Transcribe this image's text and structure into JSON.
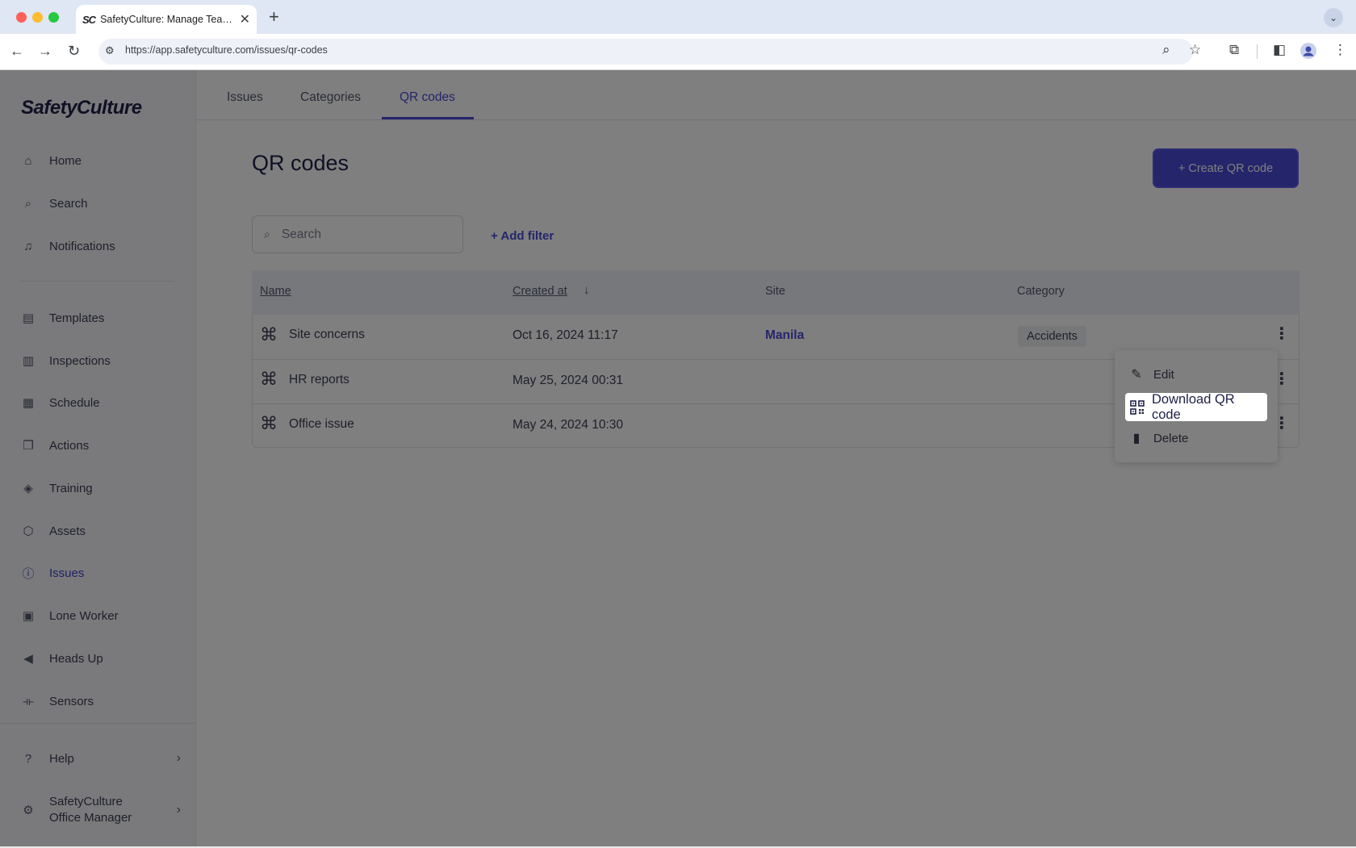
{
  "browser": {
    "tab_title": "SafetyCulture: Manage Teams and...",
    "tab_favicon": "SC",
    "url": "https://app.safetyculture.com/issues/qr-codes",
    "traffic_light_colors": [
      "#ff5f57",
      "#febc2e",
      "#28c840"
    ]
  },
  "app": {
    "logo": "SafetyCulture",
    "sidebar": {
      "items": [
        {
          "label": "Home",
          "icon": "home-icon"
        },
        {
          "label": "Search",
          "icon": "search-icon"
        },
        {
          "label": "Notifications",
          "icon": "bell-icon"
        },
        {
          "label": "Templates",
          "icon": "templates-icon"
        },
        {
          "label": "Inspections",
          "icon": "clipboard-icon"
        },
        {
          "label": "Schedule",
          "icon": "calendar-icon"
        },
        {
          "label": "Actions",
          "icon": "actions-icon"
        },
        {
          "label": "Training",
          "icon": "training-icon"
        },
        {
          "label": "Assets",
          "icon": "cube-icon"
        },
        {
          "label": "Issues",
          "icon": "issues-icon",
          "active": true
        },
        {
          "label": "Lone Worker",
          "icon": "lone-worker-icon"
        },
        {
          "label": "Heads Up",
          "icon": "megaphone-icon"
        },
        {
          "label": "Sensors",
          "icon": "sensor-icon"
        }
      ],
      "help": "Help",
      "org_line1": "SafetyCulture",
      "org_line2": "Office Manager"
    },
    "tabs": [
      "Issues",
      "Categories",
      "QR codes"
    ],
    "active_tab": "QR codes",
    "page_title": "QR codes",
    "create_button": "+ Create QR code",
    "search_placeholder": "Search",
    "add_filter": "+ Add filter",
    "table": {
      "headers": [
        "Name",
        "Created at",
        "Site",
        "Category"
      ],
      "rows": [
        {
          "name": "Site concerns",
          "created": "Oct 16, 2024 11:17",
          "site": "Manila",
          "category": "Accidents"
        },
        {
          "name": "HR reports",
          "created": "May 25, 2024 00:31",
          "site": "",
          "category": ""
        },
        {
          "name": "Office issue",
          "created": "May 24, 2024 10:30",
          "site": "",
          "category": ""
        }
      ]
    },
    "row_menu": {
      "edit": "Edit",
      "download": "Download QR code",
      "delete": "Delete"
    },
    "accent_color": "#4a4ad8"
  }
}
